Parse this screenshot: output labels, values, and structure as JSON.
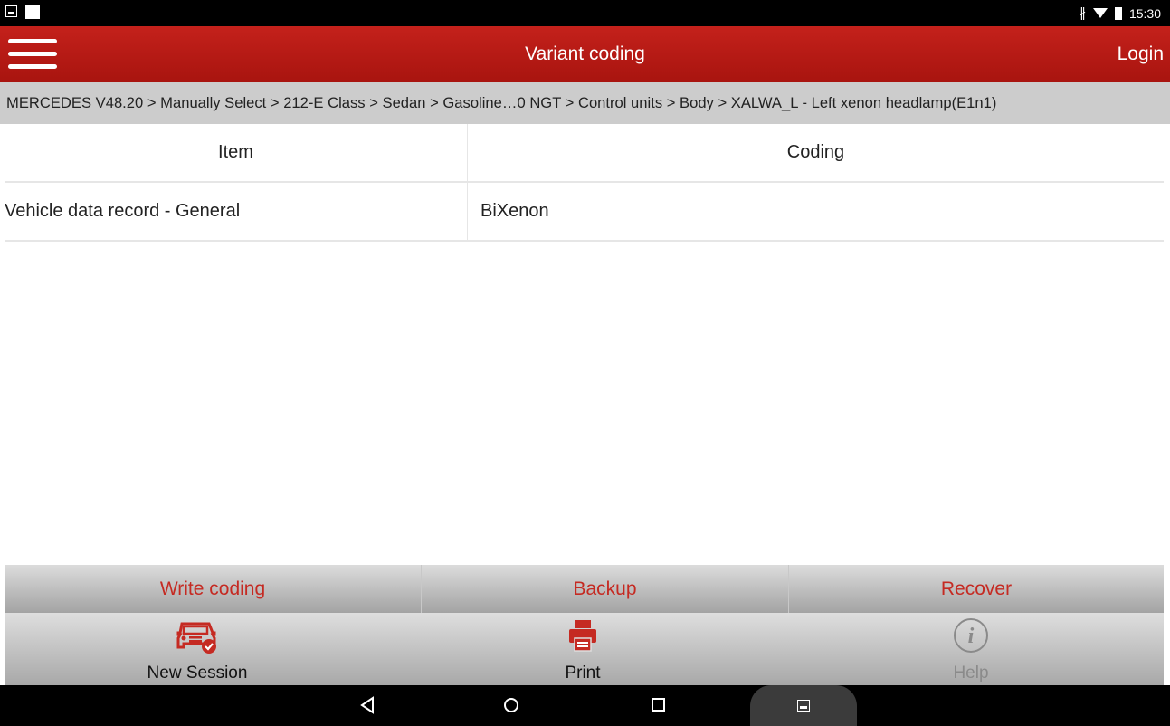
{
  "status_bar": {
    "time": "15:30",
    "icons": [
      "screenshot-icon",
      "notification-icon",
      "bluetooth-icon",
      "wifi-icon",
      "battery-icon"
    ]
  },
  "app_bar": {
    "title": "Variant coding",
    "login_label": "Login",
    "background": "#b3170f"
  },
  "breadcrumb": {
    "text": "MERCEDES V48.20 > Manually Select > 212-E Class > Sedan > Gasoline…0 NGT > Control units > Body > XALWA_L - Left xenon headlamp(E1n1)"
  },
  "table": {
    "headers": {
      "item": "Item",
      "coding": "Coding"
    },
    "rows": [
      {
        "item": "Vehicle data record - General",
        "coding": "BiXenon"
      }
    ]
  },
  "actions": {
    "write_coding": "Write coding",
    "backup": "Backup",
    "recover": "Recover",
    "color": "#c52a22"
  },
  "toolbar": {
    "new_session": "New Session",
    "print": "Print",
    "help": "Help"
  }
}
